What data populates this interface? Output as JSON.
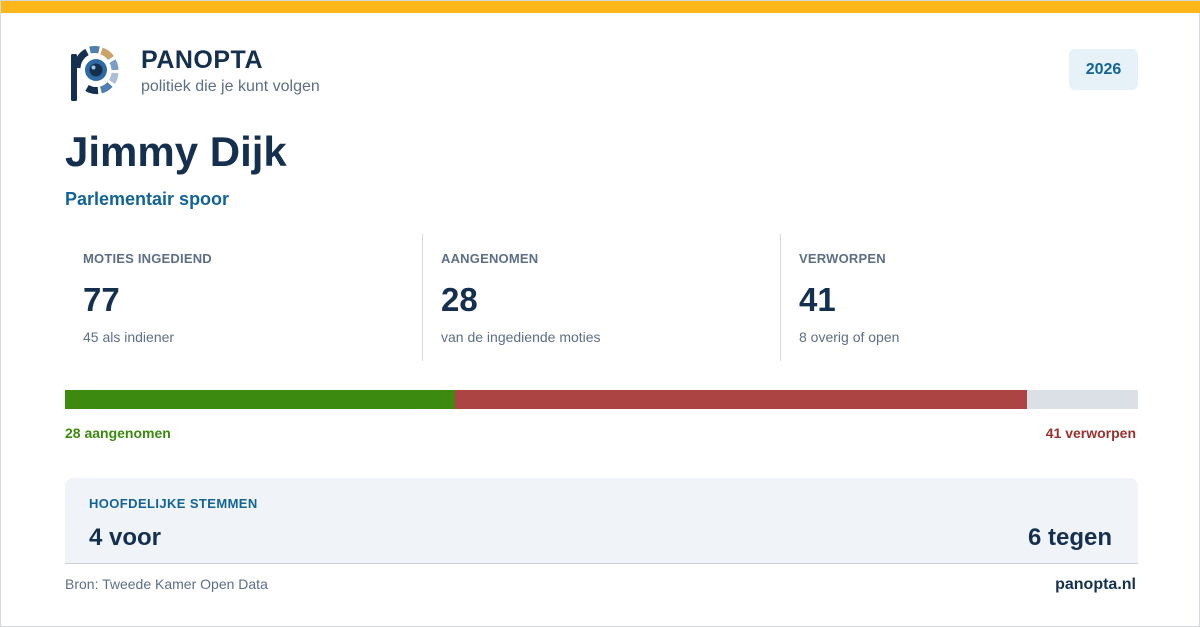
{
  "colors": {
    "accent_bar": "#fbb619",
    "navy": "#15304f",
    "blue": "#126497",
    "adopted": "#3c8a0f",
    "rejected": "#ad4444",
    "remaining": "#dbe0e6"
  },
  "brand": {
    "logo_icon": "panopta-eye-logo-icon",
    "name": "PANOPTA",
    "tagline": "politiek die je kunt volgen"
  },
  "year": "2026",
  "person": {
    "name": "Jimmy Dijk",
    "subtitle": "Parlementair spoor"
  },
  "stats": [
    {
      "label": "MOTIES INGEDIEND",
      "value": "77",
      "sub": "45 als indiener"
    },
    {
      "label": "AANGENOMEN",
      "value": "28",
      "sub": "van de ingediende moties"
    },
    {
      "label": "VERWORPEN",
      "value": "41",
      "sub": "8 overig of open"
    }
  ],
  "progress": {
    "total": 77,
    "adopted": 28,
    "rejected": 41,
    "open": 8,
    "adopted_label": "28 aangenomen",
    "rejected_label": "41 verworpen"
  },
  "votes": {
    "title": "HOOFDELIJKE STEMMEN",
    "for": "4 voor",
    "against": "6 tegen"
  },
  "footer": {
    "source": "Bron: Tweede Kamer Open Data",
    "site": "panopta.nl"
  }
}
